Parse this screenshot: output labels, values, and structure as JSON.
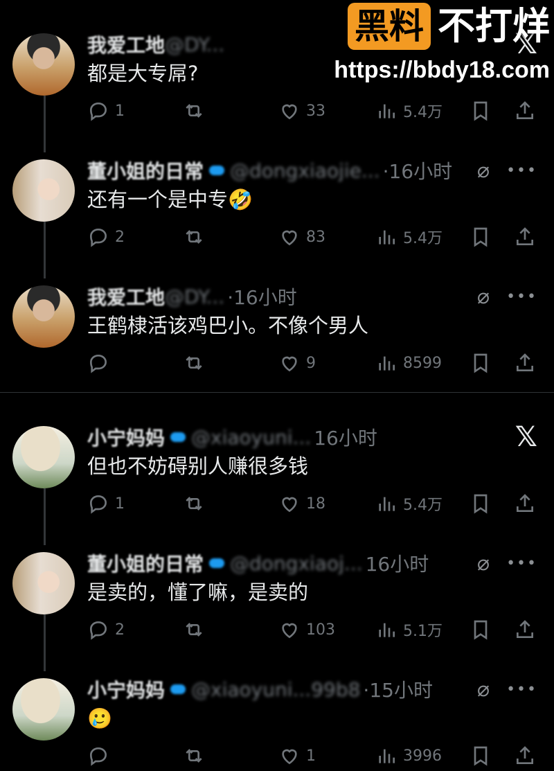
{
  "watermark": {
    "badge": "黑料",
    "title": "不打烊",
    "url": "https://bbdy18.com"
  },
  "colors": {
    "background": "#000000",
    "text": "#e7e9ea",
    "muted": "#71767b",
    "verified": "#1d9bf0",
    "watermark_badge": "#f39a22"
  },
  "thread1": {
    "tweets": [
      {
        "name": "我爱工地",
        "handle": "@DY...",
        "time": "",
        "text": "都是大专屌?",
        "reply_count": "1",
        "repost_count": "",
        "like_count": "33",
        "views": "5.4万",
        "avatar": "avatar-man-icon",
        "header_icon": "x-icon"
      },
      {
        "name": "董小姐的日常",
        "handle": "@dongxiaojie...",
        "time": "·16小时",
        "text": "还有一个是中专🤣",
        "reply_count": "2",
        "repost_count": "",
        "like_count": "83",
        "views": "5.4万",
        "avatar": "avatar-woman-icon",
        "header_icon": "grok-icon"
      },
      {
        "name": "我爱工地",
        "handle": "@DY...",
        "time": "·16小时",
        "text": "王鹤棣活该鸡巴小。不像个男人",
        "reply_count": "",
        "repost_count": "",
        "like_count": "9",
        "views": "8599",
        "avatar": "avatar-man-icon",
        "header_icon": "grok-icon"
      }
    ]
  },
  "thread2": {
    "tweets": [
      {
        "name": "小宁妈妈",
        "handle": "@xiaoyuni...",
        "time": "16小时",
        "text": "但也不妨碍别人赚很多钱",
        "reply_count": "1",
        "repost_count": "",
        "like_count": "18",
        "views": "5.4万",
        "avatar": "avatar-hat-icon",
        "header_icon": "x-icon"
      },
      {
        "name": "董小姐的日常",
        "handle": "@dongxiaoj...",
        "time": "16小时",
        "text": "是卖的，懂了嘛，是卖的",
        "reply_count": "2",
        "repost_count": "",
        "like_count": "103",
        "views": "5.1万",
        "avatar": "avatar-woman-icon",
        "header_icon": "grok-icon"
      },
      {
        "name": "小宁妈妈",
        "handle": "@xiaoyuni...99b8",
        "time": "·15小时",
        "text": "🥲",
        "reply_count": "",
        "repost_count": "",
        "like_count": "1",
        "views": "3996",
        "avatar": "avatar-hat-icon",
        "header_icon": "grok-icon"
      }
    ]
  }
}
